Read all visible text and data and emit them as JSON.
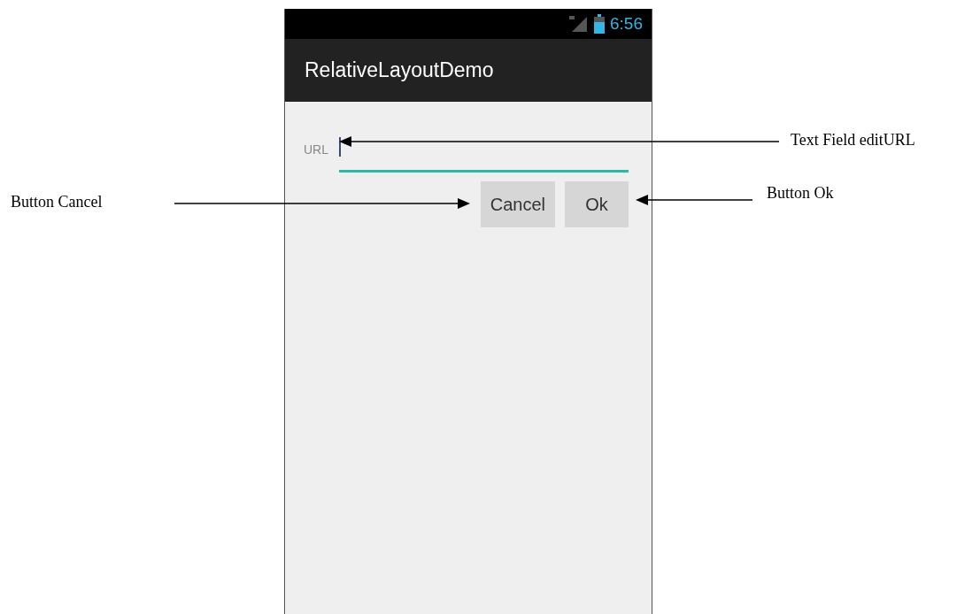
{
  "status_bar": {
    "time": "6:56"
  },
  "app_bar": {
    "title": "RelativeLayoutDemo"
  },
  "url_field": {
    "label": "URL"
  },
  "buttons": [
    {
      "label": "Cancel"
    },
    {
      "label": "Ok"
    }
  ],
  "annotations": [
    {
      "text": "Text Field  editURL"
    },
    {
      "text": "Button Cancel"
    },
    {
      "text": "Button Ok"
    }
  ]
}
